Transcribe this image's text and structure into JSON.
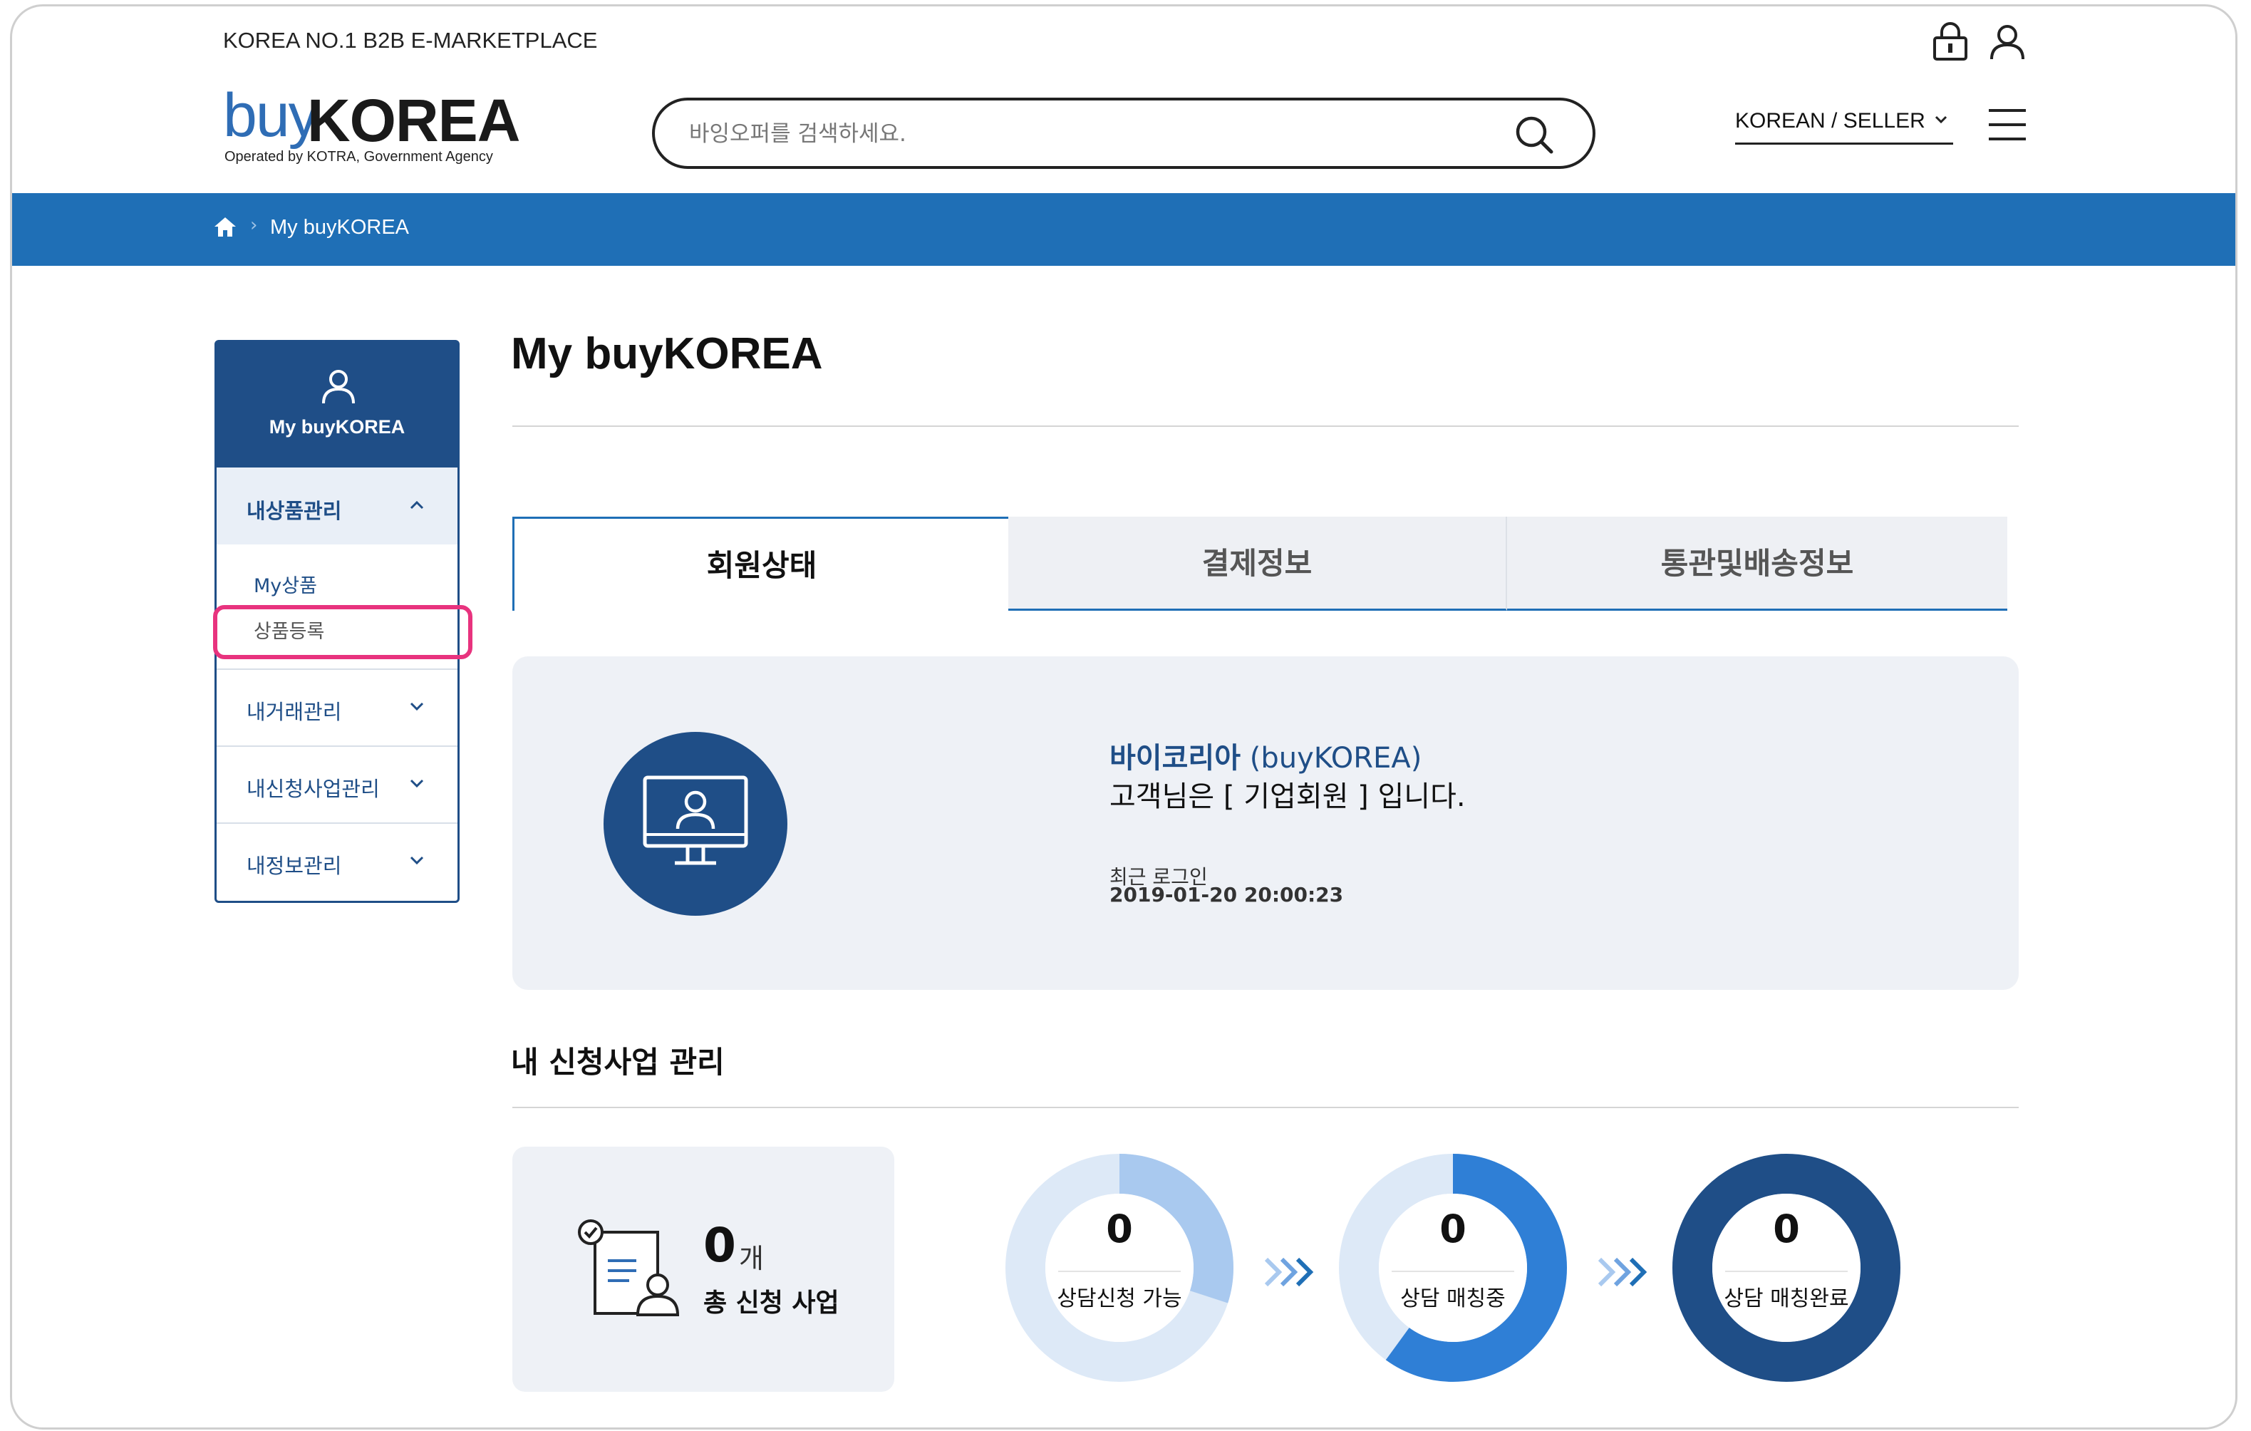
{
  "header": {
    "tagline": "KOREA NO.1 B2B E-MARKETPLACE",
    "logo": {
      "buy": "buy",
      "korea": "KOREA",
      "sub": "Operated by KOTRA, Government Agency"
    },
    "search_placeholder": "바잉오퍼를 검색하세요.",
    "language_selector": "KOREAN / SELLER"
  },
  "breadcrumb": {
    "current": "My buyKOREA"
  },
  "sidebar": {
    "title": "My buyKOREA",
    "open_section": {
      "label": "내상품관리",
      "items": [
        {
          "label": "My상품"
        },
        {
          "label": "상품등록"
        }
      ]
    },
    "sections": [
      {
        "label": "내거래관리"
      },
      {
        "label": "내신청사업관리"
      },
      {
        "label": "내정보관리"
      }
    ]
  },
  "main": {
    "title": "My buyKOREA",
    "tabs": [
      {
        "label": "회원상태",
        "active": true
      },
      {
        "label": "결제정보",
        "active": false
      },
      {
        "label": "통관및배송정보",
        "active": false
      }
    ],
    "member": {
      "name_ko": "바이코리아",
      "name_en": "(buyKOREA)",
      "status": "고객님은 [ 기업회원 ] 입니다.",
      "last_login_label": "최근 로그인",
      "last_login_time": "2019-01-20 20:00:23"
    },
    "business": {
      "title": "내 신청사업 관리",
      "total_count": "0",
      "total_unit": "개",
      "total_label": "총 신청 사업",
      "stages": [
        {
          "count": "0",
          "label": "상담신청 가능",
          "progress": 0.3
        },
        {
          "count": "0",
          "label": "상담 매칭중",
          "progress": 0.6
        },
        {
          "count": "0",
          "label": "상담 매칭완료",
          "progress": 1.0
        }
      ]
    }
  },
  "colors": {
    "brand_blue": "#1f6fb6",
    "navy": "#1f4e87",
    "highlight_pink": "#e8337e",
    "panel_bg": "#eef1f6"
  }
}
